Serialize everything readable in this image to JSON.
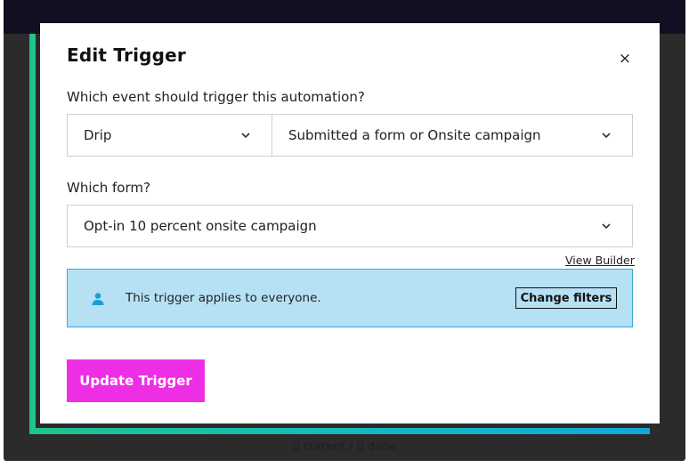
{
  "modal": {
    "title": "Edit Trigger",
    "close_icon": "close-icon",
    "event_question": "Which event should trigger this automation?",
    "event_source": "Drip",
    "event_type": "Submitted a form or Onsite campaign",
    "form_question": "Which form?",
    "form_value": "Opt-in 10 percent onsite campaign",
    "view_builder_link": "View Builder",
    "info_text": "This trigger applies to everyone.",
    "change_filters_button": "Change filters",
    "update_button": "Update Trigger"
  },
  "footer": {
    "status": "0 current / 0 done"
  },
  "colors": {
    "primary_button": "#ee2ee4",
    "info_background": "#b6e1f5",
    "info_border": "#3aa7d6",
    "user_icon": "#1b9ed8",
    "accent_gradient_start": "#1ec48e",
    "accent_gradient_end": "#12a8d8"
  }
}
